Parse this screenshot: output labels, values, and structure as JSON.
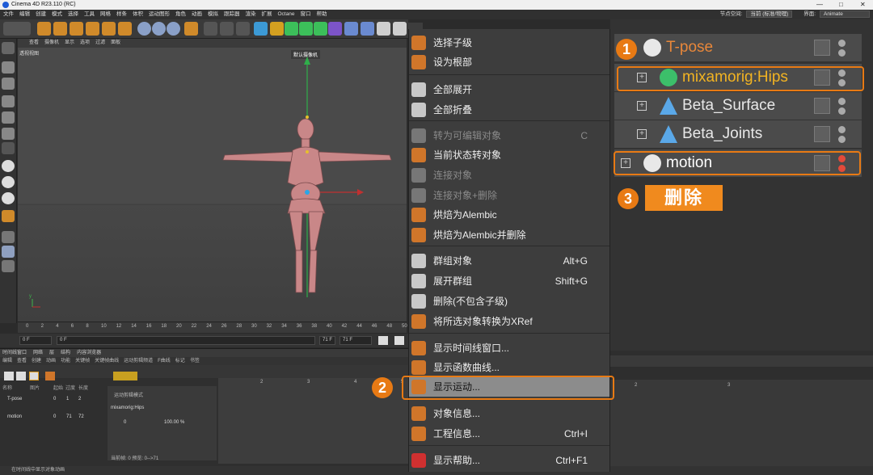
{
  "window": {
    "title": "Cinema 4D R23.110 (RC)",
    "controls": [
      "—",
      "□",
      "✕"
    ]
  },
  "menubar": {
    "items": [
      "文件",
      "编辑",
      "创建",
      "模式",
      "选择",
      "工具",
      "网格",
      "样条",
      "体积",
      "运动图形",
      "角色",
      "动画",
      "模拟",
      "跟踪器",
      "渲染",
      "扩展",
      "Octane",
      "窗口",
      "帮助"
    ],
    "node_space_label": "节点空间:",
    "node_space_value": "当前 (标准/物理)",
    "layout_label": "界面:",
    "layout_value": "Animate"
  },
  "viewport": {
    "menu": [
      "查看",
      "摄像机",
      "显示",
      "选项",
      "过滤",
      "面板"
    ],
    "view_label": "透视视图",
    "camera_label": "默认摄像机"
  },
  "timeline": {
    "ticks": [
      "0",
      "2",
      "4",
      "6",
      "8",
      "10",
      "12",
      "14",
      "16",
      "18",
      "20",
      "22",
      "24",
      "26",
      "28",
      "30",
      "32",
      "34",
      "36",
      "38",
      "40",
      "42",
      "44",
      "46",
      "48",
      "50"
    ],
    "current_frame": "0 F",
    "start_frame": "0 F",
    "end_frame": "71 F",
    "end_frame_2": "71 F"
  },
  "bottom_panel": {
    "tabs": [
      "时间线窗口",
      "网络",
      "层",
      "结构",
      "内容浏览器"
    ],
    "menu": [
      "编辑",
      "查看",
      "创建",
      "动画",
      "功能",
      "关键帧",
      "关键帧曲线",
      "运动剪辑频道",
      "F曲线",
      "标记",
      "书签"
    ],
    "headers": [
      "名称",
      "图片",
      "起始",
      "过度",
      "长度"
    ],
    "rows": [
      {
        "name": "T-pose",
        "start": "0",
        "trans": "1",
        "len": "2"
      },
      {
        "name": "motion",
        "start": "0",
        "trans": "71",
        "len": "72"
      }
    ],
    "mode_label": "运动剪辑模式",
    "layer_name": "mixamorig:Hips",
    "clip_start": "0",
    "clip_percent": "100.00 %",
    "footer": "当前帧: 0  预览: 0-->71",
    "grid_ticks": [
      "2",
      "3",
      "4",
      "5"
    ]
  },
  "right_grid_ticks": [
    "2",
    "3"
  ],
  "status_bar": "在时间线中显示对象动画",
  "context_menu": {
    "items": [
      {
        "label": "选择子级",
        "shortcut": "",
        "disabled": false,
        "highlighted": false,
        "icon": "select-children-icon"
      },
      {
        "label": "设为根部",
        "shortcut": "",
        "disabled": false,
        "highlighted": false,
        "icon": "set-root-icon"
      },
      {
        "label": "全部展开",
        "shortcut": "",
        "disabled": false,
        "highlighted": false,
        "icon": "expand-all-icon"
      },
      {
        "label": "全部折叠",
        "shortcut": "",
        "disabled": false,
        "highlighted": false,
        "icon": "collapse-all-icon"
      },
      {
        "label": "转为可编辑对象",
        "shortcut": "C",
        "disabled": true,
        "highlighted": false,
        "icon": "make-editable-icon"
      },
      {
        "label": "当前状态转对象",
        "shortcut": "",
        "disabled": false,
        "highlighted": false,
        "icon": "current-state-icon"
      },
      {
        "label": "连接对象",
        "shortcut": "",
        "disabled": true,
        "highlighted": false,
        "icon": "connect-objects-icon"
      },
      {
        "label": "连接对象+删除",
        "shortcut": "",
        "disabled": true,
        "highlighted": false,
        "icon": "connect-delete-icon"
      },
      {
        "label": "烘焙为Alembic",
        "shortcut": "",
        "disabled": false,
        "highlighted": false,
        "icon": "bake-alembic-icon"
      },
      {
        "label": "烘焙为Alembic并删除",
        "shortcut": "",
        "disabled": false,
        "highlighted": false,
        "icon": "bake-alembic-delete-icon"
      },
      {
        "label": "群组对象",
        "shortcut": "Alt+G",
        "disabled": false,
        "highlighted": false,
        "icon": "group-objects-icon"
      },
      {
        "label": "展开群组",
        "shortcut": "Shift+G",
        "disabled": false,
        "highlighted": false,
        "icon": "expand-group-icon"
      },
      {
        "label": "删除(不包含子级)",
        "shortcut": "",
        "disabled": false,
        "highlighted": false,
        "icon": "delete-without-children-icon"
      },
      {
        "label": "将所选对象转换为XRef",
        "shortcut": "",
        "disabled": false,
        "highlighted": false,
        "icon": "xref-icon"
      },
      {
        "label": "显示时间线窗口...",
        "shortcut": "",
        "disabled": false,
        "highlighted": false,
        "icon": "timeline-window-icon"
      },
      {
        "label": "显示函数曲线...",
        "shortcut": "",
        "disabled": false,
        "highlighted": false,
        "icon": "function-curve-icon"
      },
      {
        "label": "显示运动...",
        "shortcut": "",
        "disabled": false,
        "highlighted": true,
        "icon": "show-motion-icon"
      },
      {
        "label": "对象信息...",
        "shortcut": "",
        "disabled": false,
        "highlighted": false,
        "icon": "object-info-icon"
      },
      {
        "label": "工程信息...",
        "shortcut": "Ctrl+I",
        "disabled": false,
        "highlighted": false,
        "icon": "project-info-icon"
      },
      {
        "label": "显示帮助...",
        "shortcut": "Ctrl+F1",
        "disabled": false,
        "highlighted": false,
        "icon": "help-icon"
      }
    ]
  },
  "object_manager": {
    "rows": [
      {
        "name": "T-pose",
        "color": "#e8873a",
        "icon": "null-object-icon"
      },
      {
        "name": "mixamorig:Hips",
        "color": "#f2b322",
        "icon": "joint-icon"
      },
      {
        "name": "Beta_Surface",
        "color": "#e8e8e8",
        "icon": "polygon-icon"
      },
      {
        "name": "Beta_Joints",
        "color": "#e8e8e8",
        "icon": "polygon-icon"
      },
      {
        "name": "motion",
        "color": "#ffffff",
        "icon": "null-object-icon"
      }
    ]
  },
  "annotations": {
    "step1": "1",
    "step2": "2",
    "step3": "3",
    "delete_label": "删除",
    "accent": "#e87a14"
  }
}
